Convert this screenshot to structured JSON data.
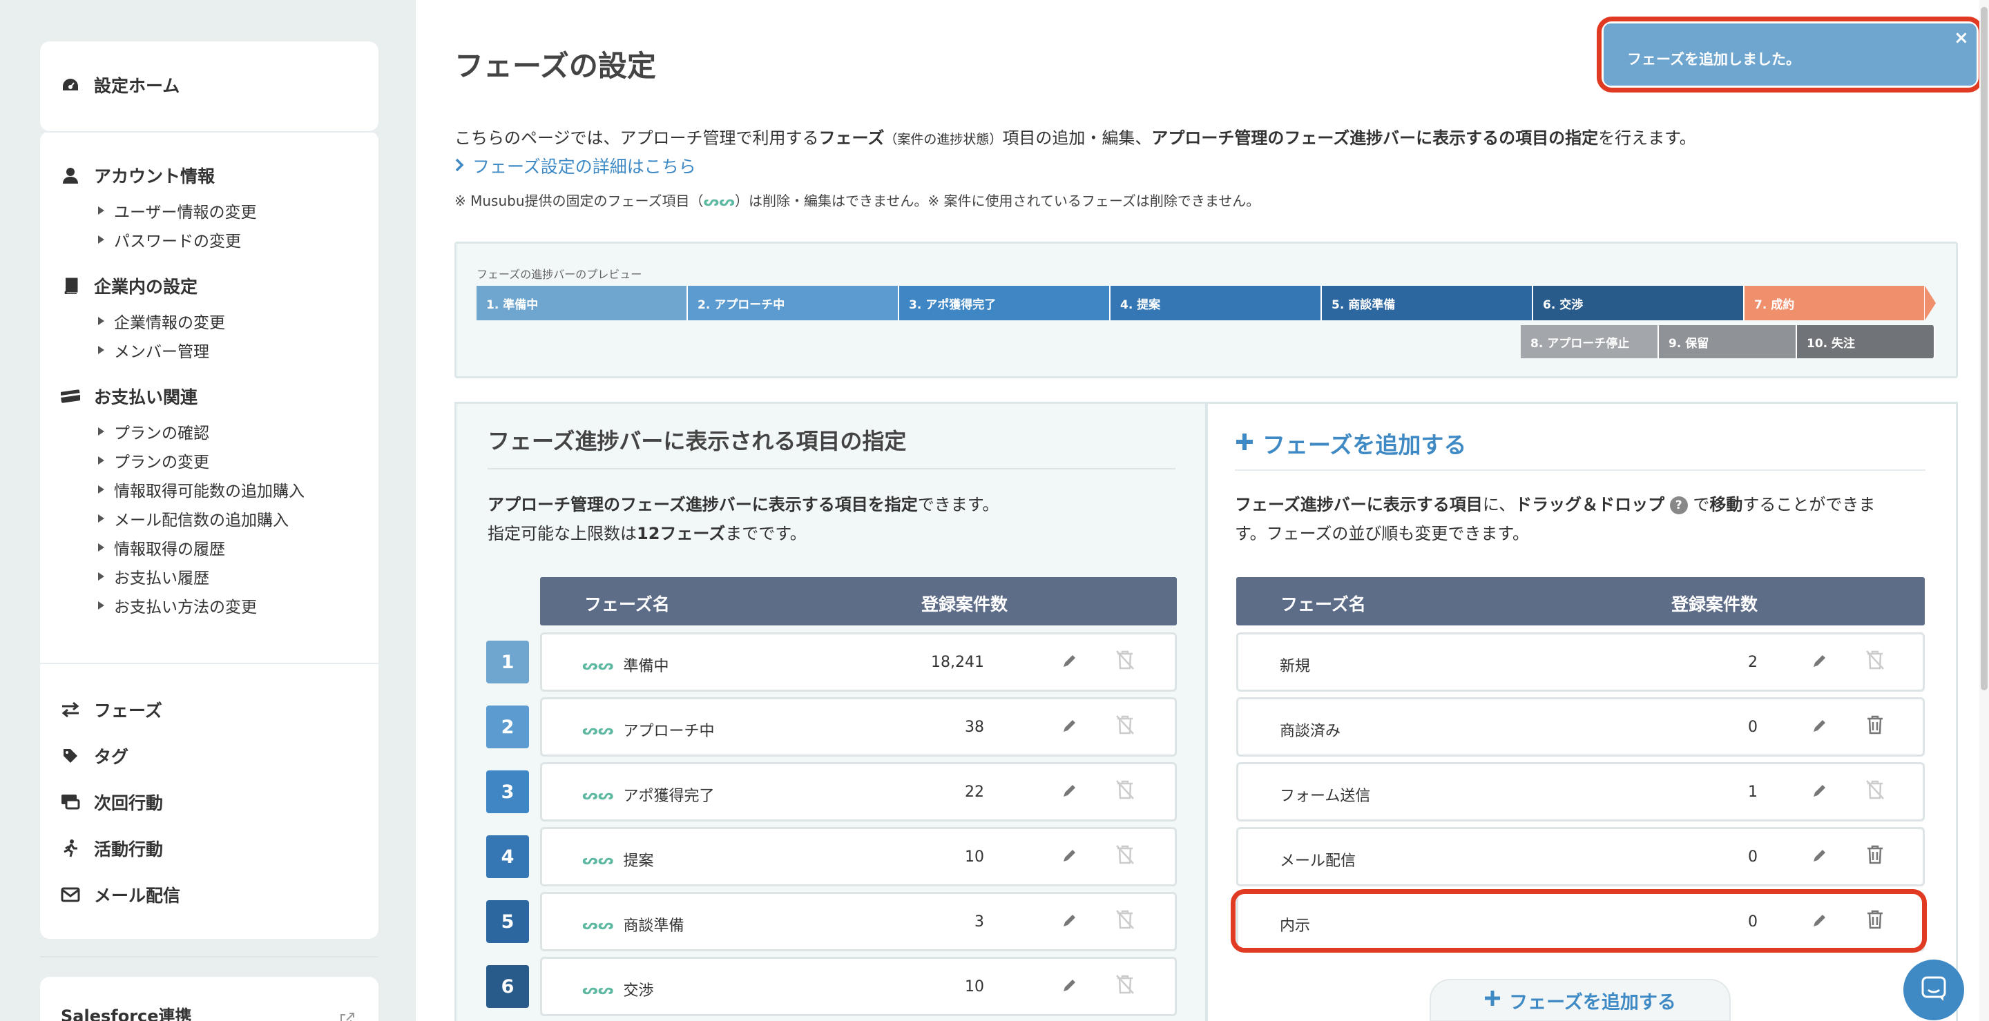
{
  "sidebar": {
    "home": "設定ホーム",
    "sections": [
      {
        "label": "アカウント情報",
        "items": [
          "ユーザー情報の変更",
          "パスワードの変更"
        ]
      },
      {
        "label": "企業内の設定",
        "items": [
          "企業情報の変更",
          "メンバー管理"
        ]
      },
      {
        "label": "お支払い関連",
        "items": [
          "プランの確認",
          "プランの変更",
          "情報取得可能数の追加購入",
          "メール配信数の追加購入",
          "情報取得の履歴",
          "お支払い履歴",
          "お支払い方法の変更"
        ]
      }
    ],
    "nav": [
      "フェーズ",
      "タグ",
      "次回行動",
      "活動行動",
      "メール配信"
    ],
    "salesforce": "Salesforce連携"
  },
  "page": {
    "title": "フェーズの設定",
    "desc_1": "こちらのページでは、アプローチ管理で利用する",
    "desc_b1": "フェーズ",
    "desc_small": "（案件の進捗状態）",
    "desc_2": "項目の追加・編集、",
    "desc_b2": "アプローチ管理のフェーズ進捗バーに表示するの項目の指定",
    "desc_3": "を行えます。",
    "detail_link": "フェーズ設定の詳細はこちら",
    "note_1": "※ Musubu提供の固定のフェーズ項目（",
    "note_m": "ᔕᔕ",
    "note_2": "）は削除・編集はできません。※ 案件に使用されているフェーズは削除できません。"
  },
  "preview": {
    "label": "フェーズの進捗バーのプレビュー",
    "top": [
      "1. 準備中",
      "2. アプローチ中",
      "3. アポ獲得完了",
      "4. 提案",
      "5. 商談準備",
      "6. 交渉",
      "7. 成約"
    ],
    "bottom": [
      "8. アプローチ停止",
      "9. 保留",
      "10. 失注"
    ]
  },
  "left_panel": {
    "title": "フェーズ進捗バーに表示される項目の指定",
    "desc_b1": "アプローチ管理のフェーズ進捗バーに表示する項目を指定",
    "desc_1": "できます。",
    "desc_2": "指定可能な上限数は",
    "desc_b2": "12フェーズ",
    "desc_3": "までです。",
    "col_name": "フェーズ名",
    "col_count": "登録案件数",
    "rows": [
      {
        "num": "1",
        "name": "準備中",
        "count": "18,241"
      },
      {
        "num": "2",
        "name": "アプローチ中",
        "count": "38"
      },
      {
        "num": "3",
        "name": "アポ獲得完了",
        "count": "22"
      },
      {
        "num": "4",
        "name": "提案",
        "count": "10"
      },
      {
        "num": "5",
        "name": "商談準備",
        "count": "3"
      },
      {
        "num": "6",
        "name": "交渉",
        "count": "10"
      }
    ]
  },
  "right_panel": {
    "add_title": "フェーズを追加する",
    "desc_1": "フェーズ進捗バーに表示する項目",
    "desc_2": "に、",
    "desc_b1": "ドラッグ＆ドロップ",
    "desc_3": "で",
    "desc_b2": "移動",
    "desc_4": "することができま",
    "desc_5": "す。フェーズの並び順も変更できます。",
    "col_name": "フェーズ名",
    "col_count": "登録案件数",
    "rows": [
      {
        "name": "新規",
        "count": "2",
        "deletable": false
      },
      {
        "name": "商談済み",
        "count": "0",
        "deletable": true
      },
      {
        "name": "フォーム送信",
        "count": "1",
        "deletable": false
      },
      {
        "name": "メール配信",
        "count": "0",
        "deletable": true
      },
      {
        "name": "内示",
        "count": "0",
        "deletable": true
      }
    ],
    "add_button": "フェーズを追加する"
  },
  "toast": {
    "message": "フェーズを追加しました。",
    "close": "×"
  },
  "colors": {
    "accent": "#3f8ac4",
    "highlight": "#e03a22",
    "table_header": "#5d6c87"
  }
}
